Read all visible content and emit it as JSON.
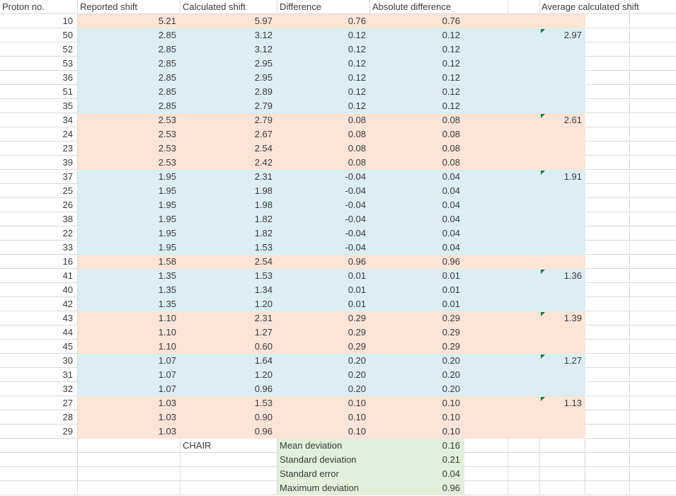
{
  "colors": {
    "band_orange": "#fce4d6",
    "band_blue": "#daeef3",
    "band_green": "#e2efda",
    "gridline": "#d9d9d9",
    "error_indicator_green": "#107c41"
  },
  "table": {
    "headers": [
      "Proton no.",
      "Reported shift",
      "Calculated shift",
      "Difference",
      "Absolute difference",
      "Average calculated shift"
    ],
    "rows": [
      {
        "proton": "10",
        "reported": "5.21",
        "calculated": "5.97",
        "difference": "0.76",
        "abs_difference": "0.76",
        "average": "",
        "band": "orange",
        "marker": false
      },
      {
        "proton": "50",
        "reported": "2.85",
        "calculated": "3.12",
        "difference": "0.12",
        "abs_difference": "0.12",
        "average": "2.97",
        "band": "blue",
        "marker": true
      },
      {
        "proton": "52",
        "reported": "2.85",
        "calculated": "3.12",
        "difference": "0.12",
        "abs_difference": "0.12",
        "average": "",
        "band": "blue",
        "marker": false
      },
      {
        "proton": "53",
        "reported": "2.85",
        "calculated": "2.95",
        "difference": "0.12",
        "abs_difference": "0.12",
        "average": "",
        "band": "blue",
        "marker": false
      },
      {
        "proton": "36",
        "reported": "2.85",
        "calculated": "2.95",
        "difference": "0.12",
        "abs_difference": "0.12",
        "average": "",
        "band": "blue",
        "marker": false
      },
      {
        "proton": "51",
        "reported": "2.85",
        "calculated": "2.89",
        "difference": "0.12",
        "abs_difference": "0.12",
        "average": "",
        "band": "blue",
        "marker": false
      },
      {
        "proton": "35",
        "reported": "2.85",
        "calculated": "2.79",
        "difference": "0.12",
        "abs_difference": "0.12",
        "average": "",
        "band": "blue",
        "marker": false
      },
      {
        "proton": "34",
        "reported": "2.53",
        "calculated": "2.79",
        "difference": "0.08",
        "abs_difference": "0.08",
        "average": "2.61",
        "band": "orange",
        "marker": true
      },
      {
        "proton": "24",
        "reported": "2.53",
        "calculated": "2.67",
        "difference": "0.08",
        "abs_difference": "0.08",
        "average": "",
        "band": "orange",
        "marker": false
      },
      {
        "proton": "23",
        "reported": "2.53",
        "calculated": "2.54",
        "difference": "0.08",
        "abs_difference": "0.08",
        "average": "",
        "band": "orange",
        "marker": false
      },
      {
        "proton": "39",
        "reported": "2.53",
        "calculated": "2.42",
        "difference": "0.08",
        "abs_difference": "0.08",
        "average": "",
        "band": "orange",
        "marker": false
      },
      {
        "proton": "37",
        "reported": "1.95",
        "calculated": "2.31",
        "difference": "-0.04",
        "abs_difference": "0.04",
        "average": "1.91",
        "band": "blue",
        "marker": true
      },
      {
        "proton": "25",
        "reported": "1.95",
        "calculated": "1.98",
        "difference": "-0.04",
        "abs_difference": "0.04",
        "average": "",
        "band": "blue",
        "marker": false
      },
      {
        "proton": "26",
        "reported": "1.95",
        "calculated": "1.98",
        "difference": "-0.04",
        "abs_difference": "0.04",
        "average": "",
        "band": "blue",
        "marker": false
      },
      {
        "proton": "38",
        "reported": "1.95",
        "calculated": "1.82",
        "difference": "-0.04",
        "abs_difference": "0.04",
        "average": "",
        "band": "blue",
        "marker": false
      },
      {
        "proton": "22",
        "reported": "1.95",
        "calculated": "1.82",
        "difference": "-0.04",
        "abs_difference": "0.04",
        "average": "",
        "band": "blue",
        "marker": false
      },
      {
        "proton": "33",
        "reported": "1.95",
        "calculated": "1.53",
        "difference": "-0.04",
        "abs_difference": "0.04",
        "average": "",
        "band": "blue",
        "marker": false
      },
      {
        "proton": "16",
        "reported": "1.58",
        "calculated": "2.54",
        "difference": "0.96",
        "abs_difference": "0.96",
        "average": "",
        "band": "orange",
        "marker": false
      },
      {
        "proton": "41",
        "reported": "1.35",
        "calculated": "1.53",
        "difference": "0.01",
        "abs_difference": "0.01",
        "average": "1.36",
        "band": "blue",
        "marker": true
      },
      {
        "proton": "40",
        "reported": "1.35",
        "calculated": "1.34",
        "difference": "0.01",
        "abs_difference": "0.01",
        "average": "",
        "band": "blue",
        "marker": false
      },
      {
        "proton": "42",
        "reported": "1.35",
        "calculated": "1.20",
        "difference": "0.01",
        "abs_difference": "0.01",
        "average": "",
        "band": "blue",
        "marker": false
      },
      {
        "proton": "43",
        "reported": "1.10",
        "calculated": "2.31",
        "difference": "0.29",
        "abs_difference": "0.29",
        "average": "1.39",
        "band": "orange",
        "marker": true
      },
      {
        "proton": "44",
        "reported": "1.10",
        "calculated": "1.27",
        "difference": "0.29",
        "abs_difference": "0.29",
        "average": "",
        "band": "orange",
        "marker": false
      },
      {
        "proton": "45",
        "reported": "1.10",
        "calculated": "0.60",
        "difference": "0.29",
        "abs_difference": "0.29",
        "average": "",
        "band": "orange",
        "marker": false
      },
      {
        "proton": "30",
        "reported": "1.07",
        "calculated": "1.64",
        "difference": "0.20",
        "abs_difference": "0.20",
        "average": "1.27",
        "band": "blue",
        "marker": true
      },
      {
        "proton": "31",
        "reported": "1.07",
        "calculated": "1.20",
        "difference": "0.20",
        "abs_difference": "0.20",
        "average": "",
        "band": "blue",
        "marker": false
      },
      {
        "proton": "32",
        "reported": "1.07",
        "calculated": "0.96",
        "difference": "0.20",
        "abs_difference": "0.20",
        "average": "",
        "band": "blue",
        "marker": false
      },
      {
        "proton": "27",
        "reported": "1.03",
        "calculated": "1.53",
        "difference": "0.10",
        "abs_difference": "0.10",
        "average": "1.13",
        "band": "orange",
        "marker": true
      },
      {
        "proton": "28",
        "reported": "1.03",
        "calculated": "0.90",
        "difference": "0.10",
        "abs_difference": "0.10",
        "average": "",
        "band": "orange",
        "marker": false
      },
      {
        "proton": "29",
        "reported": "1.03",
        "calculated": "0.96",
        "difference": "0.10",
        "abs_difference": "0.10",
        "average": "",
        "band": "orange",
        "marker": false
      }
    ],
    "footer": {
      "chair_label": "CHAIR",
      "stats": [
        {
          "label": "Mean deviation",
          "value": "0.16"
        },
        {
          "label": "Standard deviation",
          "value": "0.21"
        },
        {
          "label": "Standard error",
          "value": "0.04"
        },
        {
          "label": "Maximum deviation",
          "value": "0.96"
        }
      ]
    }
  }
}
